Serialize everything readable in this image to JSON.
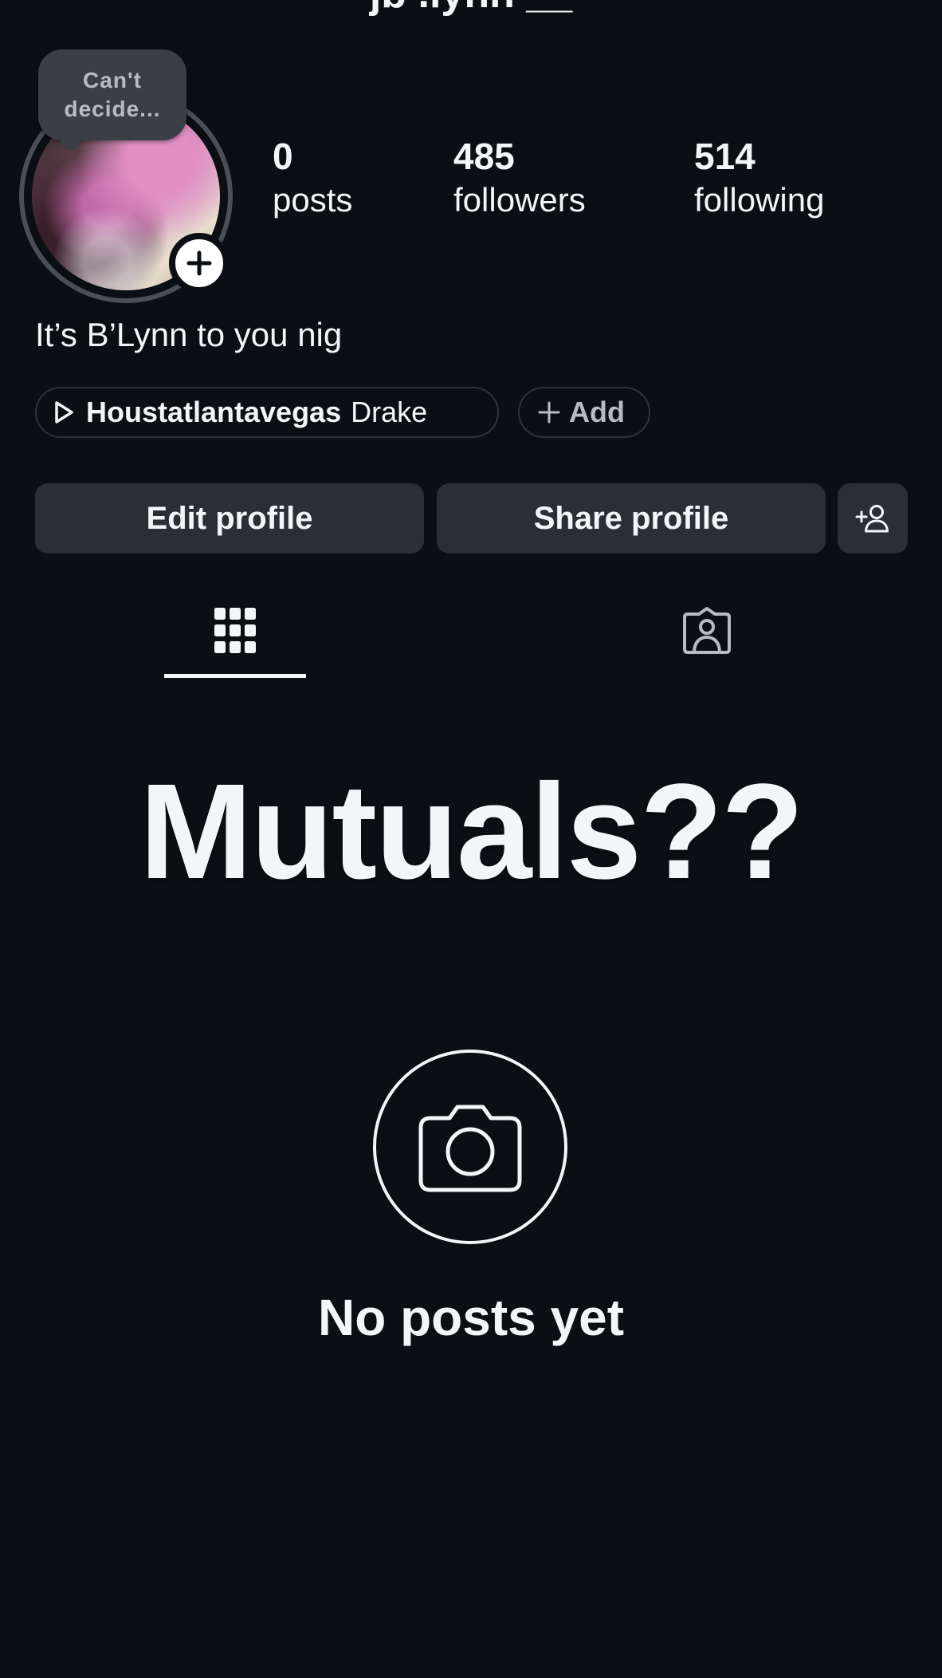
{
  "header": {
    "username_partial": "jb .lynn __"
  },
  "profile": {
    "note": "Can't\ndecide...",
    "stats": {
      "posts_value": "0",
      "posts_label": "posts",
      "followers_value": "485",
      "followers_label": "followers",
      "following_value": "514",
      "following_label": "following"
    },
    "bio": "It’s B’Lynn to you nig",
    "music": {
      "title": "Houstatlantavegas",
      "artist": "Drake"
    },
    "add_label": "Add"
  },
  "actions": {
    "edit_label": "Edit profile",
    "share_label": "Share profile"
  },
  "tabs": [
    {
      "icon": "grid-icon",
      "active": true
    },
    {
      "icon": "tagged-person-icon",
      "active": false
    }
  ],
  "overlay_text": "Mutuals??",
  "empty_state": {
    "icon": "camera-icon",
    "message": "No posts yet"
  },
  "colors": {
    "background": "#0b0f13",
    "button": "#2a2f36",
    "text": "#f4f5f7",
    "muted": "#b7bcc4"
  }
}
